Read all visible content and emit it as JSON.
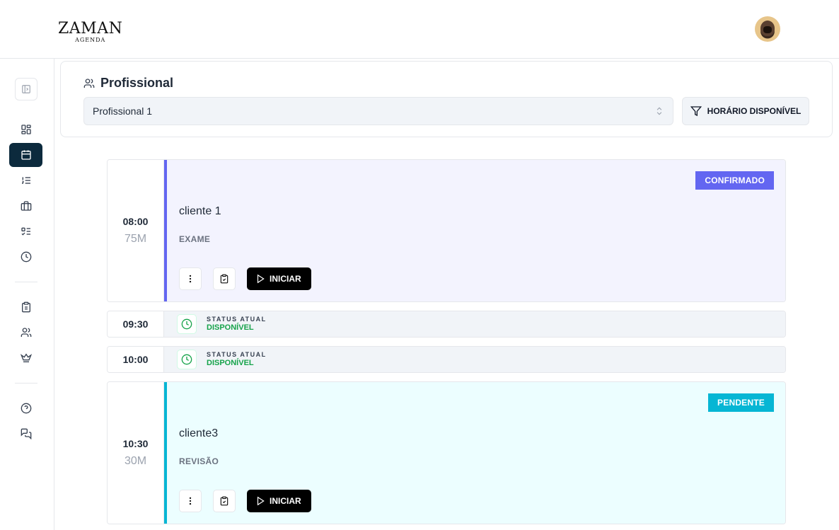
{
  "header": {
    "logo_main": "ZAMAN",
    "logo_sub": "AGENDA"
  },
  "sidebar": {
    "items": [
      {
        "name": "dashboard-icon"
      },
      {
        "name": "calendar-icon",
        "active": true
      },
      {
        "name": "list-ordered-icon"
      },
      {
        "name": "briefcase-icon"
      },
      {
        "name": "checklist-icon"
      },
      {
        "name": "clock-icon"
      },
      {
        "name": "clipboard-icon"
      },
      {
        "name": "users-icon"
      },
      {
        "name": "crown-icon"
      },
      {
        "name": "help-icon"
      },
      {
        "name": "chat-icon"
      }
    ]
  },
  "filter": {
    "title": "Profissional",
    "selected_professional": "Profissional 1",
    "available_button": "HORÁRIO DISPONÍVEL"
  },
  "schedule": [
    {
      "type": "appointment",
      "time": "08:00",
      "duration": "75M",
      "client": "cliente 1",
      "service": "EXAME",
      "status": "CONFIRMADO",
      "accent": "#6366f1",
      "background": "#f3f3fe",
      "start_label": "INICIAR"
    },
    {
      "type": "free",
      "time": "09:30",
      "status_label": "STATUS ATUAL",
      "status_value": "DISPONÍVEL"
    },
    {
      "type": "free",
      "time": "10:00",
      "status_label": "STATUS ATUAL",
      "status_value": "DISPONÍVEL"
    },
    {
      "type": "appointment",
      "time": "10:30",
      "duration": "30M",
      "client": "cliente3",
      "service": "REVISÃO",
      "status": "PENDENTE",
      "accent": "#06b6d4",
      "background": "#ecfeff",
      "start_label": "INICIAR"
    }
  ],
  "colors": {
    "sidebar_active": "#0c2a3d",
    "available_green": "#16a34a",
    "confirmed_badge": "#6366f1",
    "pending_badge": "#06b6d4"
  }
}
